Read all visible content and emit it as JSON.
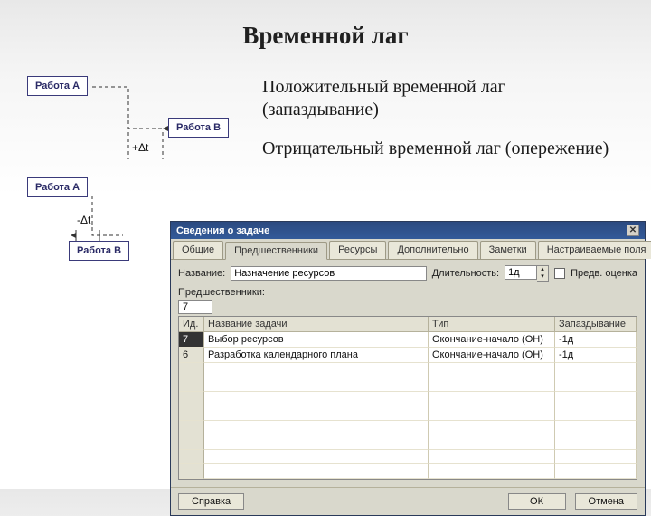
{
  "title": "Временной лаг",
  "explain": {
    "positive": "Положительный временной лаг (запаздывание)",
    "negative": "Отрицательный временной лаг (опережение)"
  },
  "diagram": {
    "node_a": "Работа А",
    "node_b": "Работа В",
    "plus_dt": "+Δt",
    "minus_dt": "-Δt"
  },
  "dialog": {
    "title": "Сведения о задаче",
    "tabs": [
      "Общие",
      "Предшественники",
      "Ресурсы",
      "Дополнительно",
      "Заметки",
      "Настраиваемые поля"
    ],
    "active_tab": 1,
    "name_label": "Название:",
    "name_value": "Назначение ресурсов",
    "duration_label": "Длительность:",
    "duration_value": "1д",
    "estimate_label": "Предв. оценка",
    "predecessors_label": "Предшественники:",
    "predecessor_marker": "7",
    "columns": [
      "Ид.",
      "Название задачи",
      "Тип",
      "Запаздывание"
    ],
    "rows": [
      {
        "id": "7",
        "name": "Выбор ресурсов",
        "type": "Окончание-начало (ОН)",
        "lag": "-1д",
        "selected": true
      },
      {
        "id": "6",
        "name": "Разработка календарного плана",
        "type": "Окончание-начало (ОН)",
        "lag": "-1д",
        "selected": false
      }
    ],
    "buttons": {
      "help": "Справка",
      "ok": "ОК",
      "cancel": "Отмена"
    }
  }
}
